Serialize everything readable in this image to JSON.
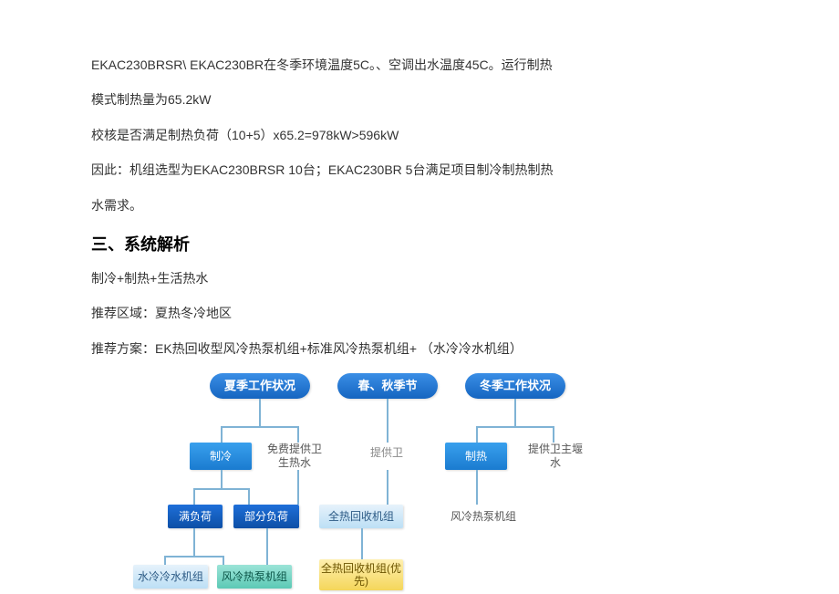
{
  "paragraphs": {
    "p1": "EKAC230BRSR\\ EKAC230BR在冬季环境温度5C。、空调出水温度45C。运行制热",
    "p2": "模式制热量为65.2kW",
    "p3": "校核是否满足制热负荷（10+5）x65.2=978kW>596kW",
    "p4": "因此：机组选型为EKAC230BRSR 10台；EKAC230BR 5台满足项目制冷制热制热",
    "p5": "水需求。"
  },
  "heading": "三、系统解析",
  "body": {
    "b1": "制冷+制热+生活热水",
    "b2": "推荐区域：夏热冬冷地区",
    "b3": "推荐方案：EK热回收型风冷热泵机组+标准风冷热泵机组+ （水冷冷水机组）"
  },
  "diagram": {
    "header": {
      "summer": "夏季工作状况",
      "spring": "春、秋季节",
      "winter": "冬季工作状况"
    },
    "row2": {
      "cooling": "制冷",
      "free_hot": "免费提供卫生热水",
      "provide": "提供卫",
      "heating": "制热",
      "provide_main": "提供卫主堰水"
    },
    "row3": {
      "full": "满负荷",
      "partial": "部分负荷",
      "recovery_all": "全热回收机组",
      "air_unit": "风冷热泵机组"
    },
    "row4": {
      "water_cooled": "水冷冷水机组",
      "air_cooled": "风冷热泵机组",
      "recovery_pref": "全热回收机组(优先)"
    }
  }
}
